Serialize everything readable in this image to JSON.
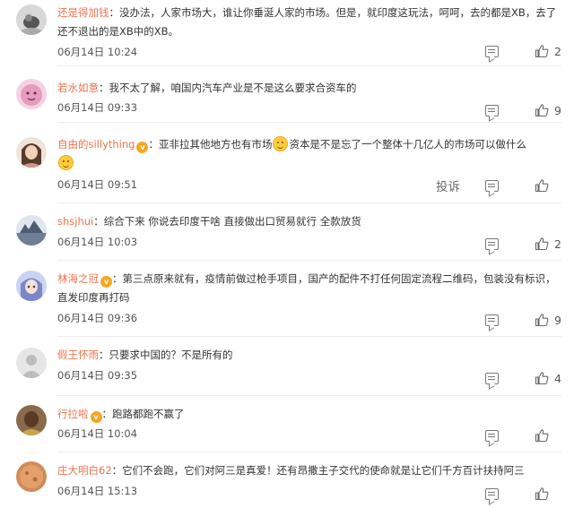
{
  "comments": [
    {
      "username": "还是得加钱",
      "text": "没办法，人家市场大，谁让你垂涎人家的市场。但是，就印度这玩法，呵呵，去的都是XB，去了还不退出的是XB中的XB。",
      "time": "06月14日 10:24",
      "likes": "2",
      "avatar_color": "#dcdcdc"
    },
    {
      "username": "若水如意",
      "text": "我不太了解，咱国内汽车产业是不是这么要求合资车的",
      "time": "06月14日 09:33",
      "likes": "9",
      "avatar_color": "#e79bc1"
    },
    {
      "username": "自由的sillything",
      "text_a": "亚非拉其他地方也有市场",
      "text_b": "资本是不是忘了一个整体十几亿人的市场可以做什么",
      "time": "06月14日 09:51",
      "report": "投诉",
      "likes": "",
      "avatar_color": "#d9b9a3"
    },
    {
      "username": "shsjhui",
      "text": "综合下来 你说去印度干啥 直接做出口贸易就行 全款放货",
      "time": "06月14日 10:03",
      "likes": "2",
      "avatar_color": "#8e9fb5"
    },
    {
      "username": "林海之冠",
      "text": "第三点原来就有，疫情前做过枪手项目，国产的配件不打任何固定流程二维码，包装没有标识，直发印度再打码",
      "time": "06月14日 09:36",
      "likes": "9",
      "avatar_color": "#a7b4e6"
    },
    {
      "username": "假王怀雨",
      "text": "只要求中国的？不是所有的",
      "time": "06月14日 09:35",
      "likes": "4",
      "avatar_color": "#e2e2e2"
    },
    {
      "username": "行拉啦",
      "text": "跑路都跑不赢了",
      "time": "06月14日 10:04",
      "likes": "",
      "avatar_color": "#6b4a2e"
    },
    {
      "username": "庄大明白62",
      "text": "它们不会跑，它们对阿三是真爱！还有昂撒主子交代的使命就是让它们千方百计扶持阿三",
      "time": "06月14日 15:13",
      "likes": "",
      "avatar_color": "#d28a5a"
    }
  ],
  "colors": {
    "username": "#eb7350",
    "badge": "#f6a623"
  },
  "icons": {
    "reply": "comment-bubble-icon",
    "like": "thumbs-up-icon",
    "emoji": "smile-emoji-icon",
    "vip": "vip-badge-icon"
  }
}
